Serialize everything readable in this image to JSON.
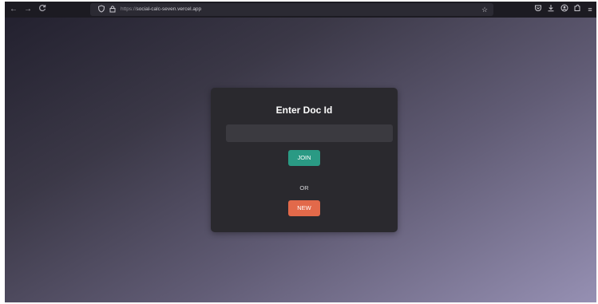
{
  "browser": {
    "url_scheme": "https://",
    "url_host": "social-calc-seven.vercel.app",
    "icons": {
      "back": "back-arrow-icon",
      "forward": "forward-arrow-icon",
      "reload": "reload-icon",
      "tracking": "shield-icon",
      "lock": "lock-icon",
      "bookmark": "star-icon",
      "pocket": "pocket-icon",
      "downloads": "download-icon",
      "account": "account-icon",
      "extensions": "extensions-icon",
      "menu": "menu-icon"
    }
  },
  "card": {
    "title": "Enter Doc Id",
    "input_value": "",
    "join_label": "JOIN",
    "or_label": "OR",
    "new_label": "NEW"
  },
  "colors": {
    "join_button": "#2a9a84",
    "new_button": "#e2694a",
    "card_background": "#2a292e"
  }
}
